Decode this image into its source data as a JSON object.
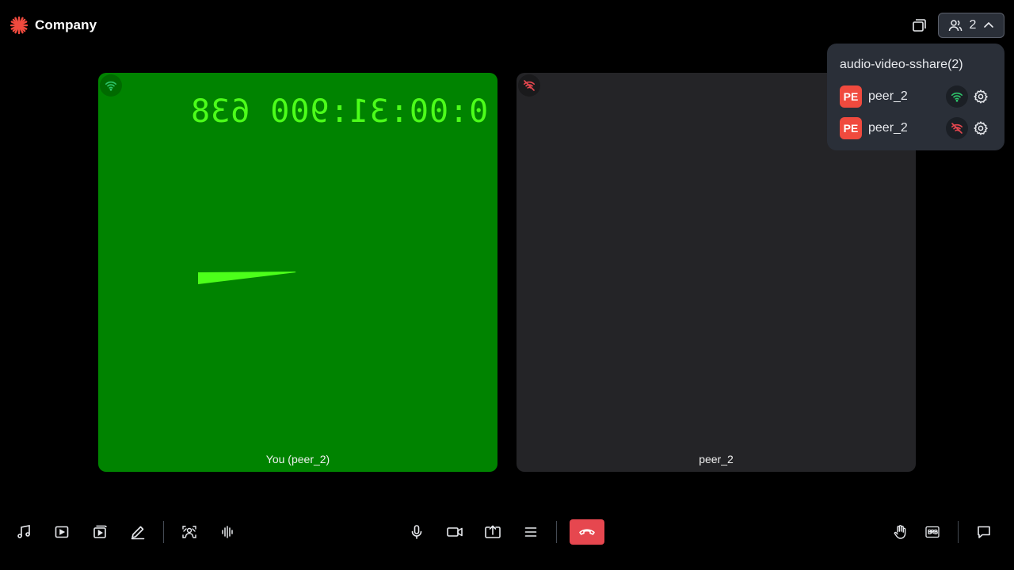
{
  "header": {
    "brand_name": "Company",
    "brand_color": "#f04a3e",
    "participant_count": "2"
  },
  "participants_panel": {
    "title": "audio-video-sshare(2)",
    "peers": [
      {
        "initials": "PE",
        "name": "peer_2",
        "network": "good"
      },
      {
        "initials": "PE",
        "name": "peer_2",
        "network": "disconnected"
      }
    ]
  },
  "tiles": [
    {
      "label": "You (peer_2)",
      "background": "#008300",
      "network": "good",
      "video_timecode": "0:00:31:900 638"
    },
    {
      "label": "peer_2",
      "background": "#242427",
      "network": "disconnected"
    }
  ],
  "toolbar": {
    "left": [
      "music-icon",
      "play-video-icon",
      "media-icon",
      "pen-icon",
      "virtual-background-icon",
      "noise-suppression-icon"
    ],
    "center": [
      "microphone-icon",
      "camera-icon",
      "screen-share-icon",
      "menu-icon",
      "leave-call-icon"
    ],
    "right": [
      "raise-hand-icon",
      "brb-icon",
      "chat-icon"
    ],
    "leave_color": "#e6474f"
  },
  "colors": {
    "network_good": "#2ec46b",
    "network_bad": "#e6474f",
    "clock_text": "#4cff1a"
  }
}
